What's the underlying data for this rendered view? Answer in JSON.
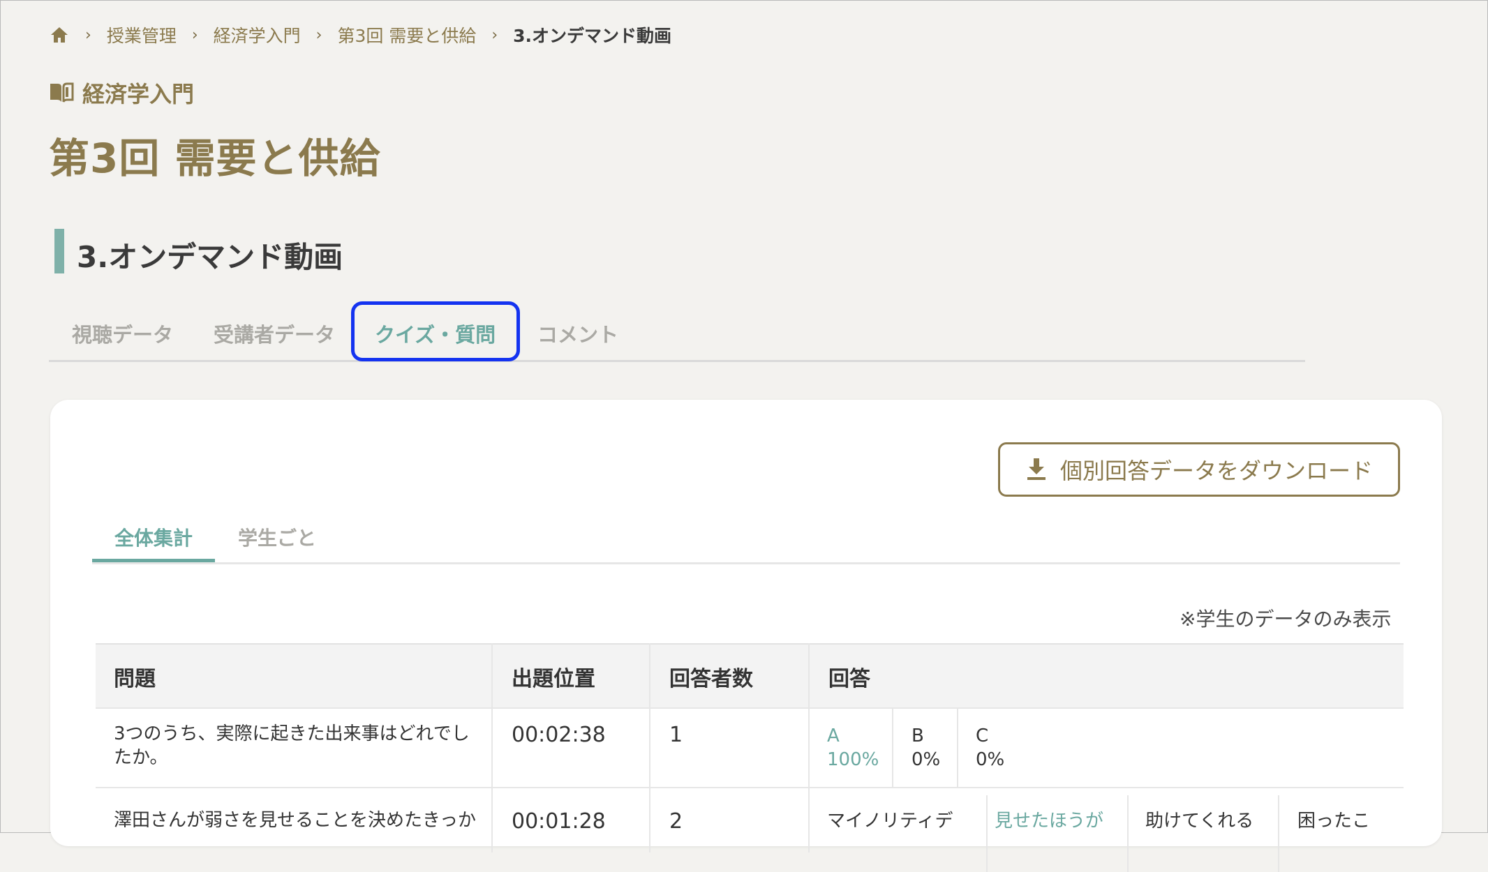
{
  "breadcrumb": {
    "items": [
      "授業管理",
      "経済学入門",
      "第3回 需要と供給"
    ],
    "current": "3.オンデマンド動画"
  },
  "course": {
    "name": "経済学入門",
    "icon": "book-icon"
  },
  "lecture": {
    "title": "第3回 需要と供給"
  },
  "section": {
    "title": "3.オンデマンド動画"
  },
  "tabs": [
    {
      "label": "視聴データ"
    },
    {
      "label": "受講者データ"
    },
    {
      "label": "クイズ・質問",
      "active": true
    },
    {
      "label": "コメント"
    }
  ],
  "download": {
    "label": "個別回答データをダウンロード",
    "icon": "download-icon"
  },
  "subtabs": [
    {
      "label": "全体集計",
      "active": true
    },
    {
      "label": "学生ごと"
    }
  ],
  "note": "※学生のデータのみ表示",
  "table": {
    "headers": {
      "question": "問題",
      "position": "出題位置",
      "respondents": "回答者数",
      "answers": "回答"
    },
    "rows": [
      {
        "question_line1": "3つのうち、実際に起きた出来事はどれでし",
        "question_line2": "たか。",
        "position": "00:02:38",
        "respondents": "1",
        "answers": [
          {
            "label": "A",
            "value": "100%"
          },
          {
            "label": "B",
            "value": "0%"
          },
          {
            "label": "C",
            "value": "0%"
          }
        ]
      },
      {
        "question_line1": "澤田さんが弱さを見せることを決めたきっか",
        "position": "00:01:28",
        "respondents": "2",
        "answers": [
          {
            "label": "マイノリティデ"
          },
          {
            "label": "見せたほうが"
          },
          {
            "label": "助けてくれる"
          },
          {
            "label": "困ったこ"
          }
        ]
      }
    ]
  },
  "colors": {
    "accent": "#6aa8a0",
    "brand": "#8b7a4d",
    "highlight": "#1433f0",
    "background": "#f3f2ef"
  }
}
